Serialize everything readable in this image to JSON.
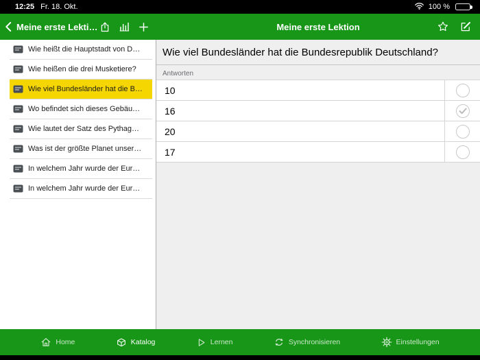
{
  "colors": {
    "accent_green": "#189618",
    "selected_highlight": "#f5d600",
    "status_black": "#000000"
  },
  "status_bar": {
    "time": "12:25",
    "date": "Fr. 18. Okt.",
    "battery_percent": "100 %"
  },
  "nav": {
    "left_title": "Meine erste Lekti…",
    "right_title": "Meine erste Lektion"
  },
  "sidebar": {
    "items": [
      {
        "label": "Wie heißt die Hauptstadt von D…"
      },
      {
        "label": "Wie heißen die drei Musketiere?"
      },
      {
        "label": "Wie viel Bundesländer hat die B…"
      },
      {
        "label": "Wo befindet sich dieses Gebäu…"
      },
      {
        "label": "Wie lautet der Satz des Pythag…"
      },
      {
        "label": "Was ist der größte Planet unser…"
      },
      {
        "label": "In welchem Jahr wurde der Eur…"
      },
      {
        "label": "In welchem Jahr wurde der Eur…"
      }
    ]
  },
  "main": {
    "question": "Wie viel Bundesländer hat die Bundesrepublik Deutschland?",
    "answers_label": "Antworten",
    "answers": [
      {
        "text": "10",
        "checked": false
      },
      {
        "text": "16",
        "checked": true
      },
      {
        "text": "20",
        "checked": false
      },
      {
        "text": "17",
        "checked": false
      }
    ]
  },
  "tab_bar": {
    "items": [
      {
        "label": "Home",
        "active": false
      },
      {
        "label": "Katalog",
        "active": true
      },
      {
        "label": "Lernen",
        "active": false
      },
      {
        "label": "Synchronisieren",
        "active": false
      },
      {
        "label": "Einstellungen",
        "active": false
      }
    ]
  }
}
